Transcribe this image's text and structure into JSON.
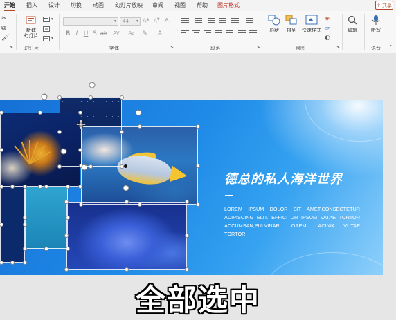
{
  "ribbon": {
    "tabs": [
      {
        "label": "开始"
      },
      {
        "label": "插入"
      },
      {
        "label": "设计"
      },
      {
        "label": "切换"
      },
      {
        "label": "动画"
      },
      {
        "label": "幻灯片放映"
      },
      {
        "label": "审阅"
      },
      {
        "label": "视图"
      },
      {
        "label": "帮助"
      },
      {
        "label": "图片格式"
      }
    ],
    "share_label": "共享",
    "groups": {
      "slides": {
        "label": "幻灯片",
        "new_slide": "新建\n幻灯片"
      },
      "font": {
        "label": "字体",
        "font_size": "44"
      },
      "paragraph": {
        "label": "段落"
      },
      "drawing": {
        "label": "绘图",
        "shapes": "形状",
        "arrange": "排列",
        "quick_styles": "快速样式"
      },
      "editing": {
        "label": "编辑"
      },
      "voice": {
        "label": "语音",
        "dictate": "听写"
      }
    }
  },
  "slide": {
    "title": "德总的私人海洋世界",
    "body": "LOREM IPSUM DOLOR SIT AMET,CONSECTETUR ADIPISCING ELIT. EFFICITUR IPSUM VATAE TORTOR ACCUMSAN,PULVINAR LOREM LACINIA VUTAE TORTOR."
  },
  "caption": "全部选中",
  "colors": {
    "accent": "#b7472a",
    "slide_blue": "#1f8be8"
  }
}
